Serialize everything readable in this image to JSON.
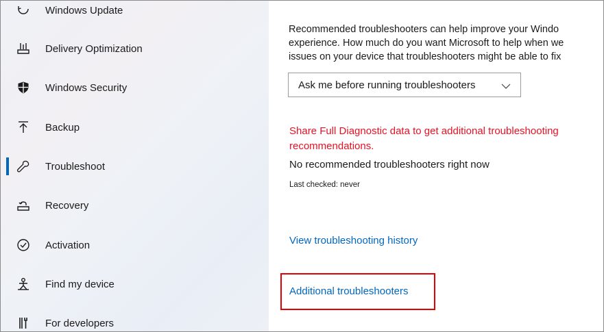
{
  "sidebar": {
    "items": [
      {
        "label": "Windows Update",
        "icon": "sync-icon"
      },
      {
        "label": "Delivery Optimization",
        "icon": "delivery-optimization-icon"
      },
      {
        "label": "Windows Security",
        "icon": "shield-icon"
      },
      {
        "label": "Backup",
        "icon": "upload-icon"
      },
      {
        "label": "Troubleshoot",
        "icon": "wrench-icon",
        "active": true
      },
      {
        "label": "Recovery",
        "icon": "recovery-icon"
      },
      {
        "label": "Activation",
        "icon": "check-circle-icon"
      },
      {
        "label": "Find my device",
        "icon": "person-location-icon"
      },
      {
        "label": "For developers",
        "icon": "developer-tools-icon"
      }
    ]
  },
  "main": {
    "description_lines": [
      "Recommended troubleshooters can help improve your Windo",
      "experience. How much do you want Microsoft to help when we",
      "issues on your device that troubleshooters might be able to fix"
    ],
    "dropdown": {
      "selected": "Ask me before running troubleshooters"
    },
    "diagnostic_link": "Share Full Diagnostic data to get additional troubleshooting recommendations.",
    "status_text": "No recommended troubleshooters right now",
    "last_checked": "Last checked: never",
    "history_link": "View troubleshooting history",
    "additional_link": "Additional troubleshooters"
  },
  "colors": {
    "accent": "#0067c0",
    "warning_link": "#e81123",
    "highlight": "#e30000"
  }
}
